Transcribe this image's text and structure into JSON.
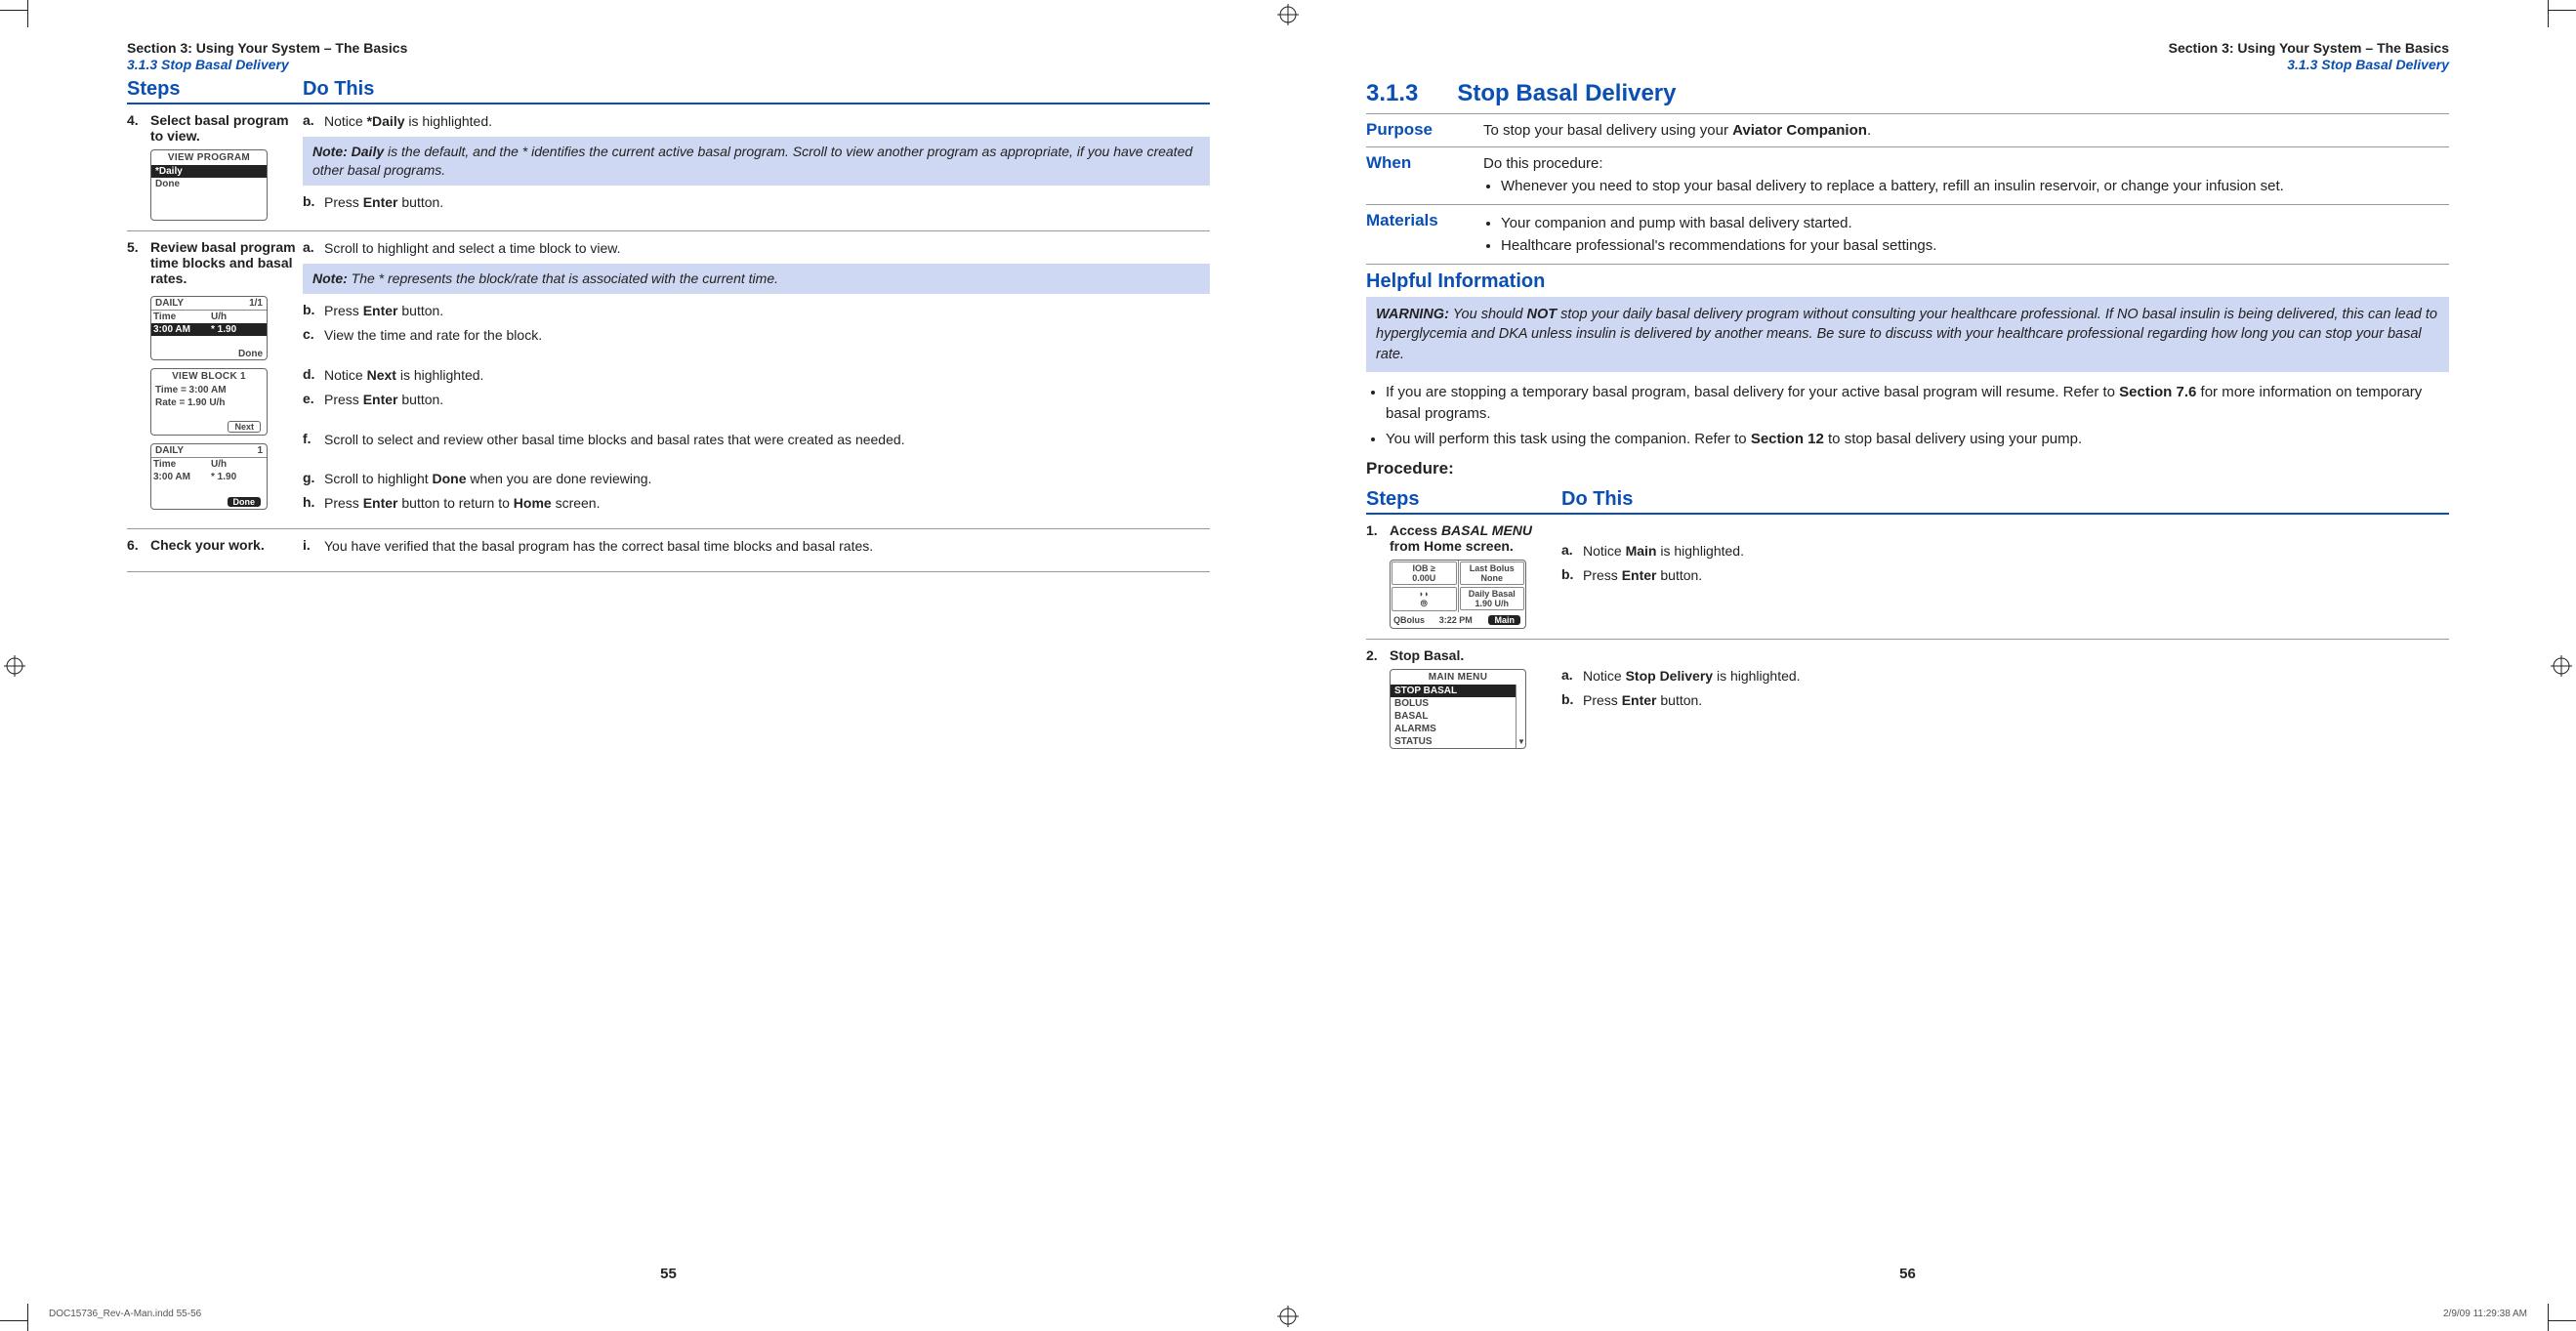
{
  "header": {
    "section_line": "Section 3: Using Your System – The Basics",
    "sub_line": "3.1.3 Stop Basal Delivery"
  },
  "columns": {
    "steps": "Steps",
    "do_this": "Do This"
  },
  "left": {
    "step4": {
      "num": "4.",
      "title": "Select basal program to view.",
      "a": {
        "l": "a.",
        "pre": "Notice ",
        "bold": "*Daily",
        "post": " is highlighted."
      },
      "note": {
        "lead": "Note: Daily",
        "rest": " is the default, and the * identifies the current active basal program. Scroll to view another program as appropriate, if you have created other basal programs."
      },
      "b": {
        "l": "b.",
        "pre": "Press ",
        "bold": "Enter",
        "post": " button."
      },
      "screen": {
        "title": "VIEW PROGRAM",
        "hl": "*Daily",
        "row": "Done"
      }
    },
    "step5": {
      "num": "5.",
      "title": "Review basal program time blocks and basal rates.",
      "a": {
        "l": "a.",
        "t": "Scroll to highlight and select a time block to view."
      },
      "note": {
        "lead": "Note:",
        "rest": " The * represents the block/rate that is associated with the current time."
      },
      "b": {
        "l": "b.",
        "pre": "Press ",
        "bold": "Enter",
        "post": " button."
      },
      "c": {
        "l": "c.",
        "t": "View the time and rate for the block."
      },
      "d": {
        "l": "d.",
        "pre": "Notice ",
        "bold": "Next",
        "post": " is highlighted."
      },
      "e": {
        "l": "e.",
        "pre": "Press ",
        "bold": "Enter",
        "post": " button."
      },
      "f": {
        "l": "f.",
        "t": "Scroll to select and review other basal time blocks and basal rates that were created as needed."
      },
      "g": {
        "l": "g.",
        "pre": "Scroll to highlight ",
        "bold": "Done",
        "post": " when you are done reviewing."
      },
      "h": {
        "l": "h.",
        "pre": "Press ",
        "bold": "Enter",
        "post": " button to return to ",
        "bold2": "Home",
        "post2": " screen."
      },
      "scr1": {
        "title": "DAILY",
        "page": "1/1",
        "th1": "Time",
        "th2": "U/h",
        "r1a": "3:00 AM",
        "r1b": "* 1.90",
        "done": "Done"
      },
      "scr2": {
        "title": "VIEW BLOCK 1",
        "l1": "Time = 3:00 AM",
        "l2": "Rate = 1.90 U/h",
        "next": "Next"
      },
      "scr3": {
        "title": "DAILY",
        "page": "1",
        "th1": "Time",
        "th2": "U/h",
        "r1a": "3:00 AM",
        "r1b": "* 1.90",
        "done": "Done"
      }
    },
    "step6": {
      "num": "6.",
      "title": "Check your work.",
      "i": {
        "l": "i.",
        "t": "You have verified that the basal program has the correct basal time blocks and basal rates."
      }
    },
    "page_num": "55"
  },
  "right": {
    "title_num": "3.1.3",
    "title_text": "Stop Basal Delivery",
    "purpose": {
      "label": "Purpose",
      "pre": "To stop your basal delivery using your ",
      "bold": "Aviator Companion",
      "post": "."
    },
    "when": {
      "label": "When",
      "intro": "Do this procedure:",
      "b1": "Whenever you need to stop your basal delivery to replace a battery, refill an insulin reservoir, or change your infusion set."
    },
    "materials": {
      "label": "Materials",
      "b1": "Your companion and pump with basal delivery started.",
      "b2": "Healthcare professional's recommendations for your basal settings."
    },
    "helpful": "Helpful Information",
    "warning": {
      "lead": "WARNING:",
      "t1": " You should ",
      "not": "NOT",
      "t2": " stop your daily basal delivery program without consulting your healthcare professional. If NO basal insulin is being delivered, this can lead to hyperglycemia and DKA unless insulin is delivered by another means. Be sure to discuss with your healthcare professional regarding how long you can stop your basal rate."
    },
    "bul1": {
      "pre": "If you are stopping a temporary basal program, basal delivery for your active basal program will resume. Refer to ",
      "bold": "Section 7.6",
      "post": " for more information on temporary basal programs."
    },
    "bul2": {
      "pre": "You will perform this task using the companion. Refer to ",
      "bold": "Section 12",
      "post": " to stop basal delivery using your pump."
    },
    "procedure": "Procedure:",
    "step1": {
      "num": "1.",
      "title_pre": "Access ",
      "title_bold": "BASAL MENU",
      "title_post": " from Home screen.",
      "a": {
        "l": "a.",
        "pre": "Notice ",
        "bold": "Main",
        "post": " is highlighted."
      },
      "b": {
        "l": "b.",
        "pre": "Press ",
        "bold": "Enter",
        "post": " button."
      },
      "scr": {
        "iob_l": "IOB ≥",
        "iob_v": "0.00U",
        "lb_l": "Last Bolus",
        "lb_v": "None",
        "db_l": "Daily Basal",
        "db_v": "1.90 U/h",
        "qb": "QBolus",
        "time": "3:22 PM",
        "main": "Main"
      }
    },
    "step2": {
      "num": "2.",
      "title": "Stop Basal.",
      "a": {
        "l": "a.",
        "pre": "Notice ",
        "bold": "Stop Delivery",
        "post": " is highlighted."
      },
      "b": {
        "l": "b.",
        "pre": "Press ",
        "bold": "Enter",
        "post": " button."
      },
      "scr": {
        "title": "MAIN MENU",
        "hl": "STOP BASAL",
        "i1": "BOLUS",
        "i2": "BASAL",
        "i3": "ALARMS",
        "i4": "STATUS"
      }
    },
    "page_num": "56"
  },
  "footer": {
    "left": "DOC15736_Rev-A-Man.indd   55-56",
    "right": "2/9/09   11:29:38 AM"
  }
}
